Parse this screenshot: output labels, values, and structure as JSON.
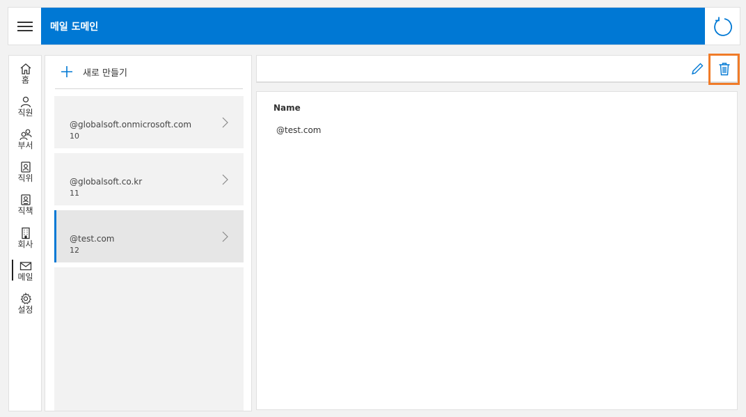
{
  "header": {
    "title": "메일 도메인",
    "menu_icon": "hamburger-icon",
    "refresh_icon": "refresh-icon",
    "accent_color": "#0078d4"
  },
  "sidebar": {
    "items": [
      {
        "label": "홈",
        "icon": "home-icon"
      },
      {
        "label": "직원",
        "icon": "person-icon"
      },
      {
        "label": "부서",
        "icon": "people-icon"
      },
      {
        "label": "직위",
        "icon": "badge-icon"
      },
      {
        "label": "직책",
        "icon": "contact-card-icon"
      },
      {
        "label": "회사",
        "icon": "building-icon"
      },
      {
        "label": "메일",
        "icon": "mail-icon",
        "active": true
      },
      {
        "label": "설정",
        "icon": "gear-icon"
      }
    ]
  },
  "list": {
    "new_label": "새로 만들기",
    "items": [
      {
        "domain": "@globalsoft.onmicrosoft.com",
        "count": "10"
      },
      {
        "domain": "@globalsoft.co.kr",
        "count": "11"
      },
      {
        "domain": "@test.com",
        "count": "12",
        "selected": true
      }
    ]
  },
  "toolbar": {
    "edit_icon": "pencil-icon",
    "delete_icon": "trash-icon",
    "highlight_color": "#f07b28"
  },
  "detail": {
    "name_label": "Name",
    "name_value": "@test.com"
  }
}
